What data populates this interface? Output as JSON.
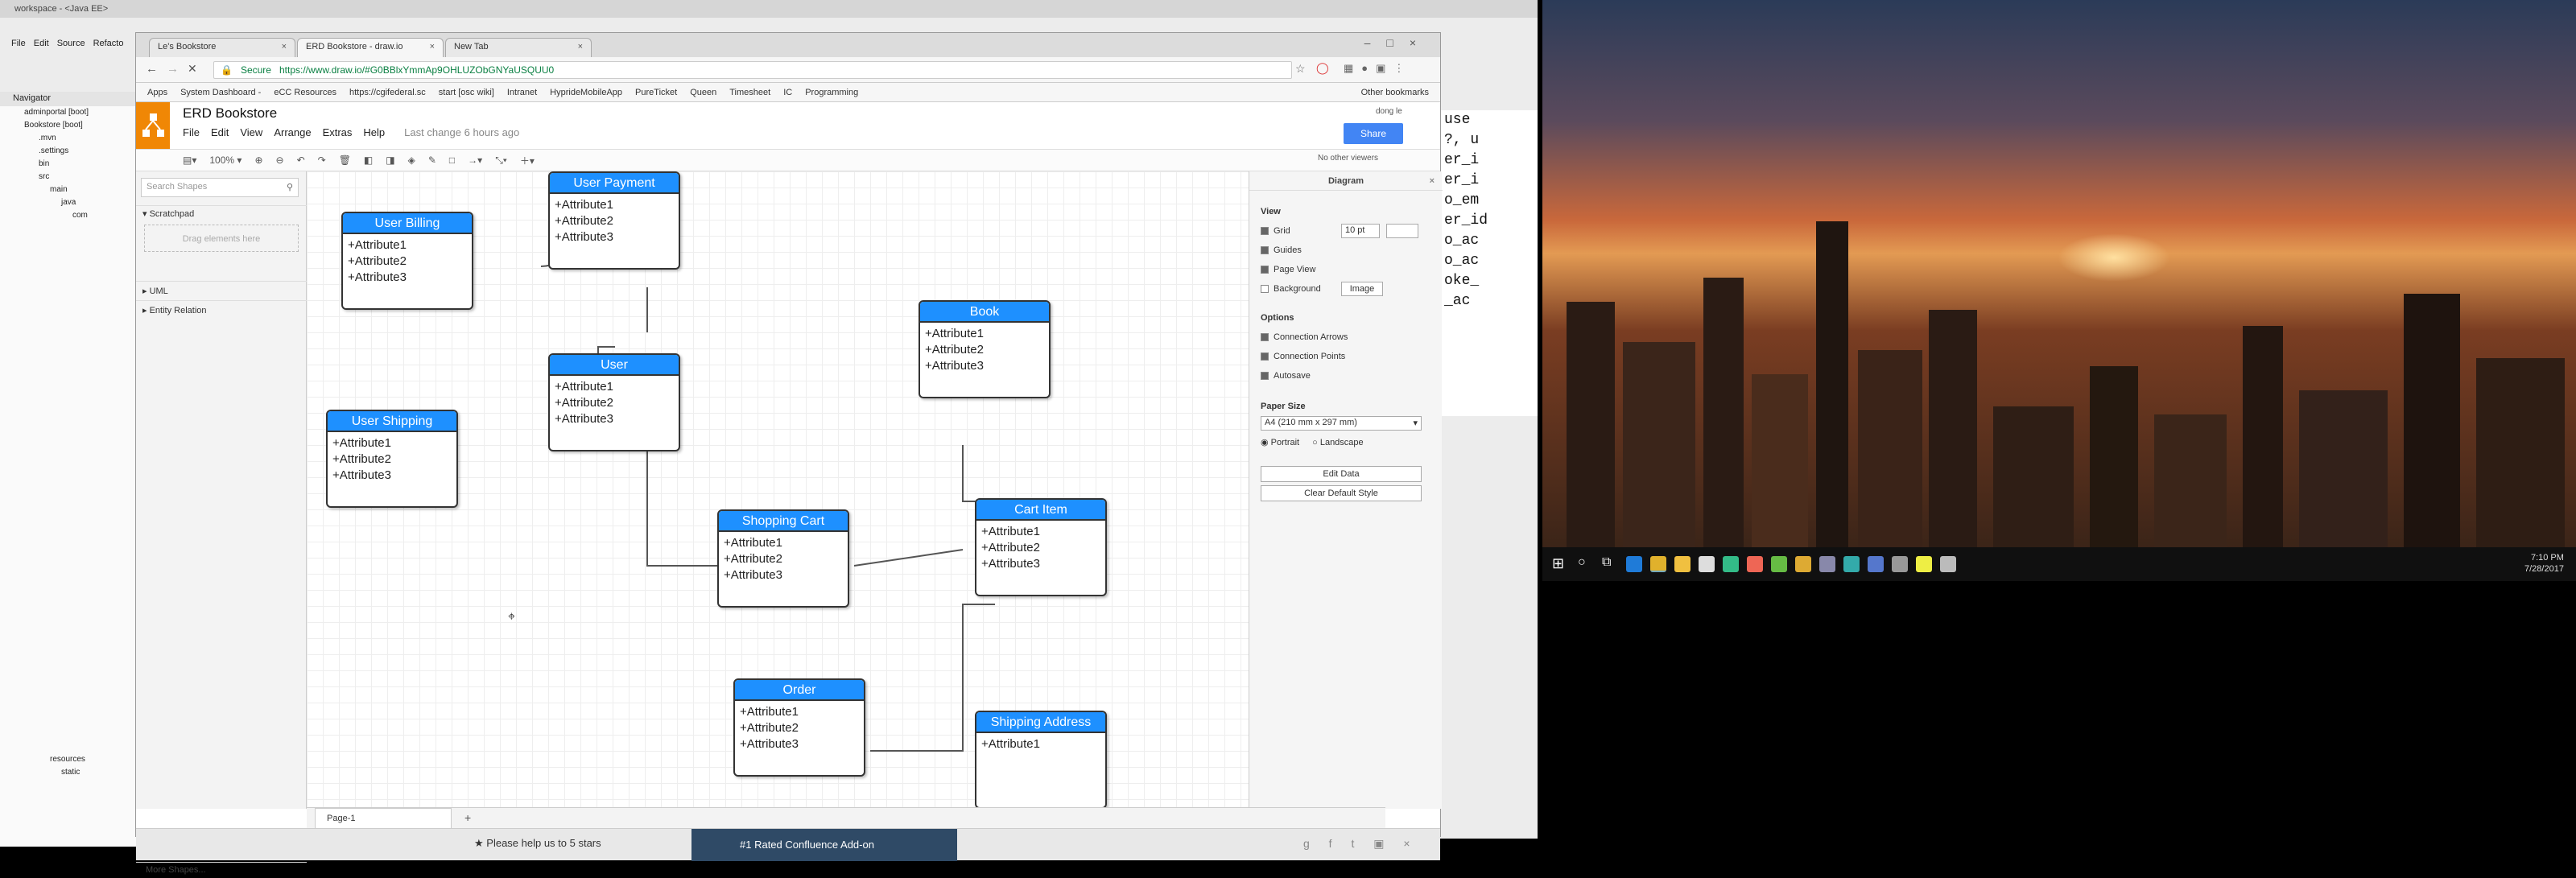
{
  "eclipse": {
    "title": "workspace - <Java EE>",
    "menu": [
      "File",
      "Edit",
      "Source",
      "Refacto"
    ],
    "navigator_title": "Navigator",
    "tree": [
      "adminportal [boot]",
      "Bookstore [boot]",
      ".mvn",
      ".settings",
      "bin",
      "src",
      "main",
      "java",
      "com",
      "resources",
      "static"
    ],
    "code_lines": [
      "use",
      "?, u",
      "er_i",
      "er_i",
      "o_em",
      "er_id",
      "o_ac",
      "o_ac",
      "oke_",
      "_ac"
    ]
  },
  "chrome": {
    "tabs": [
      {
        "label": "Le's Bookstore",
        "active": false
      },
      {
        "label": "ERD Bookstore - draw.io",
        "active": true
      },
      {
        "label": "New Tab",
        "active": false
      }
    ],
    "secure_label": "Secure",
    "url": "https://www.draw.io/#G0BBlxYmmAp9OHLUZObGNYaUSQUU0",
    "bookmarks": [
      "Apps",
      "System Dashboard -",
      "eCC Resources",
      "https://cgifederal.sc",
      "start [osc wiki]",
      "Intranet",
      "HyprideMobileApp",
      "PureTicket",
      "Queen",
      "Timesheet",
      "IC",
      "Programming",
      "Other bookmarks"
    ]
  },
  "drawio": {
    "title": "ERD Bookstore",
    "menu": [
      "File",
      "Edit",
      "View",
      "Arrange",
      "Extras",
      "Help"
    ],
    "last_change": "Last change 6 hours ago",
    "user": "dong le",
    "share_label": "Share",
    "zoom": "100%",
    "no_viewers": "No other viewers",
    "search_placeholder": "Search Shapes",
    "scratchpad": "Scratchpad",
    "drag_hint": "Drag elements here",
    "sections": [
      "UML",
      "Entity Relation"
    ],
    "more_shapes": "More Shapes...",
    "page_tab": "Page-1",
    "format": {
      "header": "Diagram",
      "view_label": "View",
      "grid": "Grid",
      "grid_size": "10 pt",
      "guides": "Guides",
      "page_view": "Page View",
      "background": "Background",
      "image_btn": "Image",
      "options_label": "Options",
      "connection_arrows": "Connection Arrows",
      "connection_points": "Connection Points",
      "autosave": "Autosave",
      "paper_size_label": "Paper Size",
      "paper_size": "A4 (210 mm x 297 mm)",
      "portrait": "Portrait",
      "landscape": "Landscape",
      "edit_data": "Edit Data",
      "clear_style": "Clear Default Style"
    },
    "entities": [
      {
        "name": "User Payment",
        "attrs": [
          "+Attribute1",
          "+Attribute2",
          "+Attribute3"
        ]
      },
      {
        "name": "User Billing",
        "attrs": [
          "+Attribute1",
          "+Attribute2",
          "+Attribute3"
        ]
      },
      {
        "name": "User",
        "attrs": [
          "+Attribute1",
          "+Attribute2",
          "+Attribute3"
        ]
      },
      {
        "name": "User Shipping",
        "attrs": [
          "+Attribute1",
          "+Attribute2",
          "+Attribute3"
        ]
      },
      {
        "name": "Book",
        "attrs": [
          "+Attribute1",
          "+Attribute2",
          "+Attribute3"
        ]
      },
      {
        "name": "Shopping Cart",
        "attrs": [
          "+Attribute1",
          "+Attribute2",
          "+Attribute3"
        ]
      },
      {
        "name": "Cart Item",
        "attrs": [
          "+Attribute1",
          "+Attribute2",
          "+Attribute3"
        ]
      },
      {
        "name": "Order",
        "attrs": [
          "+Attribute1",
          "+Attribute2",
          "+Attribute3"
        ]
      },
      {
        "name": "Shipping Address",
        "attrs": [
          "+Attribute1"
        ]
      }
    ],
    "bottom_rate": "Please help us to 5 stars",
    "bottom_confluence": "#1 Rated Confluence Add-on"
  },
  "taskbar": {
    "time": "7:10 PM",
    "date": "7/28/2017"
  },
  "colors": {
    "entity_header": "#1e90ff",
    "drawio_orange": "#f08705",
    "share_blue": "#4285f4"
  }
}
